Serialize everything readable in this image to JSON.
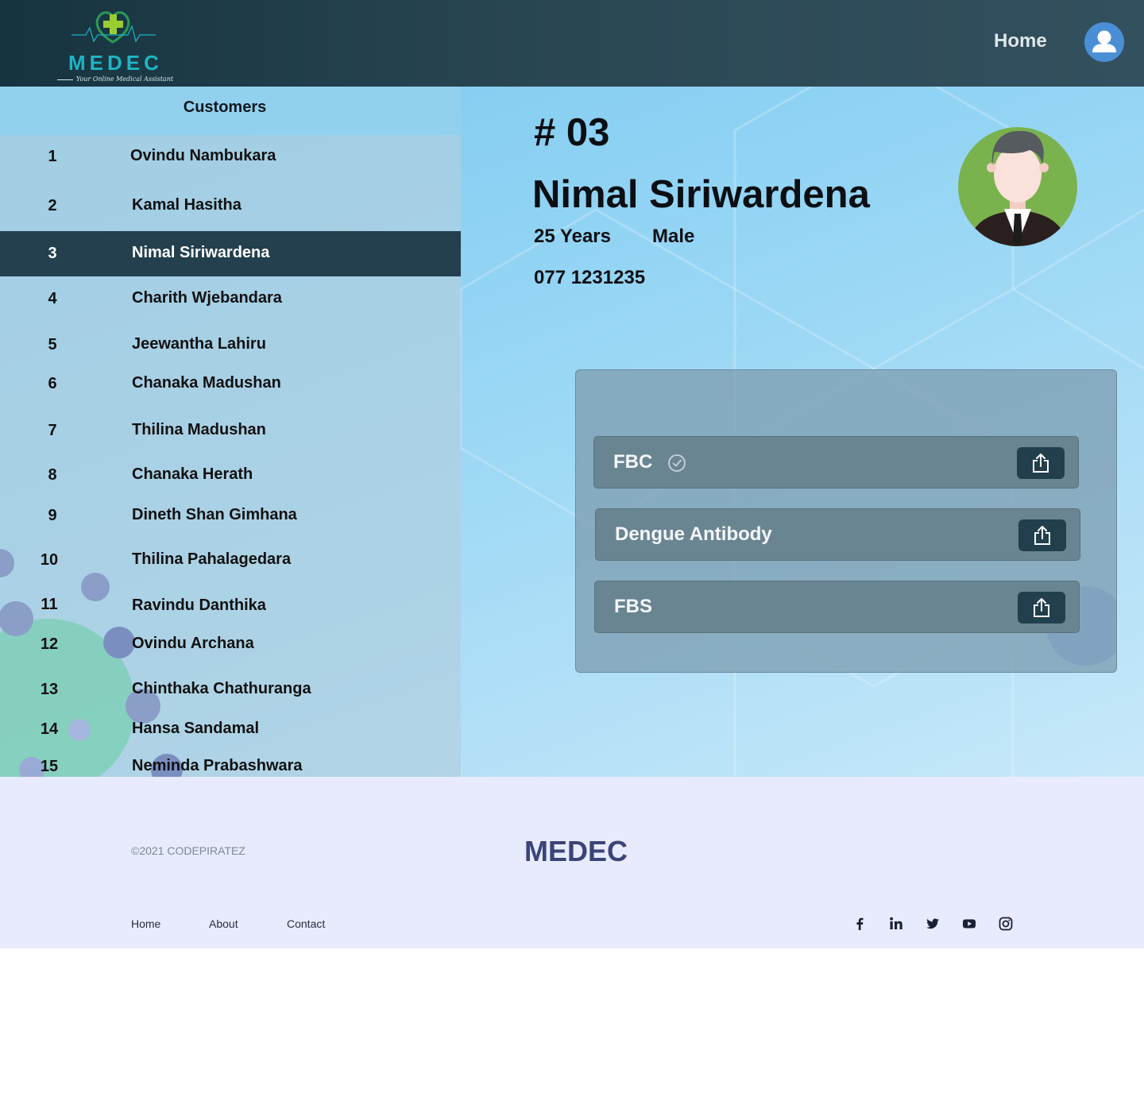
{
  "header": {
    "logo": {
      "brand": "MEDEC",
      "tagline": "Your Online Medical Assistant"
    },
    "nav": {
      "home_label": "Home"
    }
  },
  "sidebar": {
    "title": "Customers",
    "selected_index": 3,
    "customers": [
      {
        "num": "1",
        "name": "Ovindu Nambukara"
      },
      {
        "num": "2",
        "name": "Kamal Hasitha"
      },
      {
        "num": "3",
        "name": "Nimal Siriwardena"
      },
      {
        "num": "4",
        "name": "Charith Wjebandara"
      },
      {
        "num": "5",
        "name": "Jeewantha Lahiru"
      },
      {
        "num": "6",
        "name": "Chanaka Madushan"
      },
      {
        "num": "7",
        "name": "Thilina Madushan"
      },
      {
        "num": "8",
        "name": "Chanaka Herath"
      },
      {
        "num": "9",
        "name": "Dineth Shan Gimhana"
      },
      {
        "num": "10",
        "name": "Thilina Pahalagedara"
      },
      {
        "num": "11",
        "name": "Ravindu Danthika"
      },
      {
        "num": "12",
        "name": "Ovindu Archana"
      },
      {
        "num": "13",
        "name": "Chinthaka Chathuranga"
      },
      {
        "num": "14",
        "name": "Hansa Sandamal"
      },
      {
        "num": "15",
        "name": "Neminda Prabashwara"
      }
    ]
  },
  "patient": {
    "id": "# 03",
    "name": "Nimal Siriwardena",
    "age": "25 Years",
    "gender": "Male",
    "phone": "077 1231235"
  },
  "tests": [
    {
      "name": "FBC",
      "completed": true,
      "action_icon": "upload-icon"
    },
    {
      "name": "Dengue Antibody",
      "completed": false,
      "action_icon": "upload-icon"
    },
    {
      "name": "FBS",
      "completed": false,
      "action_icon": "upload-icon"
    }
  ],
  "footer": {
    "copyright": "©2021 CODEPIRATEZ",
    "brand": "MEDEC",
    "links": [
      "Home",
      "About",
      "Contact"
    ],
    "social": [
      "facebook-icon",
      "linkedin-icon",
      "twitter-icon",
      "youtube-icon",
      "instagram-icon"
    ]
  },
  "colors": {
    "header_bg": "#243f4e",
    "selected_row": "#243f4e",
    "upload_button": "#213f4d",
    "brand_teal": "#1fb4c4",
    "footer_bg": "#e8ebfe",
    "footer_brand": "#3a4478"
  }
}
